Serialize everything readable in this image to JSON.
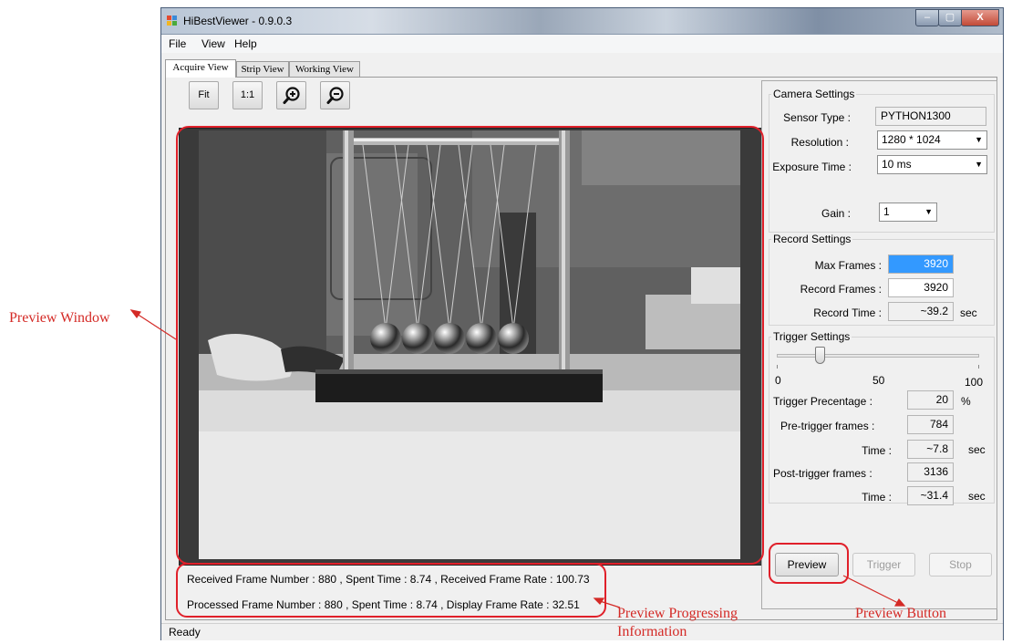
{
  "window": {
    "title": "HiBestViewer - 0.9.0.3",
    "controls": {
      "minimize": "‒",
      "maximize": "▢",
      "close": "X"
    }
  },
  "menu": {
    "file": "File",
    "view": "View",
    "help": "Help"
  },
  "tabs": {
    "acquire": "Acquire View",
    "strip": "Strip View",
    "working": "Working View"
  },
  "toolbar": {
    "fit": "Fit",
    "one_to_one": "1:1",
    "zoom_in_icon": "zoom-in-icon",
    "zoom_out_icon": "zoom-out-icon"
  },
  "camera_settings": {
    "title": "Camera Settings",
    "sensor_type_label": "Sensor Type :",
    "sensor_type_value": "PYTHON1300",
    "resolution_label": "Resolution :",
    "resolution_value": "1280 * 1024",
    "exposure_label": "Exposure Time :",
    "exposure_value": "10 ms",
    "gain_label": "Gain :",
    "gain_value": "1"
  },
  "record_settings": {
    "title": "Record Settings",
    "max_frames_label": "Max Frames :",
    "max_frames_value": "3920",
    "record_frames_label": "Record Frames :",
    "record_frames_value": "3920",
    "record_time_label": "Record Time :",
    "record_time_value": "~39.2",
    "record_time_unit": "sec"
  },
  "trigger_settings": {
    "title": "Trigger Settings",
    "slider_percent": 20,
    "scale_min": "0",
    "scale_mid": "50",
    "scale_max": "100",
    "trigger_pct_label": "Trigger Precentage :",
    "trigger_pct_value": "20",
    "trigger_pct_unit": "%",
    "pre_frames_label": "Pre-trigger frames :",
    "pre_frames_value": "784",
    "pre_time_label": "Time :",
    "pre_time_value": "~7.8",
    "pre_time_unit": "sec",
    "post_frames_label": "Post-trigger frames :",
    "post_frames_value": "3136",
    "post_time_label": "Time :",
    "post_time_value": "~31.4",
    "post_time_unit": "sec"
  },
  "buttons": {
    "preview": "Preview",
    "trigger": "Trigger",
    "stop": "Stop"
  },
  "info": {
    "received": "Received Frame Number : 880 , Spent Time : 8.74 , Received Frame Rate : 100.73",
    "processed": "Processed Frame Number : 880 , Spent Time : 8.74 ,  Display Frame Rate : 32.51"
  },
  "status": {
    "text": "Ready"
  },
  "annotations": {
    "preview_window": "Preview Window",
    "preview_info_line1": "Preview Progressing",
    "preview_info_line2": "Information",
    "preview_button": "Preview Button",
    "color": "#d42a26"
  }
}
